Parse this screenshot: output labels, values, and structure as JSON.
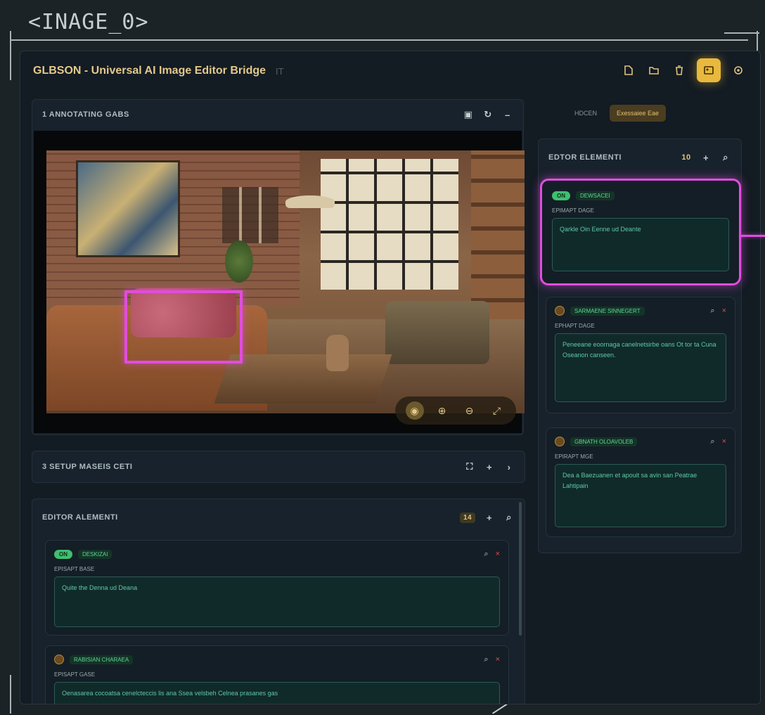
{
  "frame_tag": "<INAGE_0>",
  "app": {
    "title": "GLBSON - Universal AI Image Editor Bridge",
    "title_suffix": "IT"
  },
  "toolbar": {
    "icons": [
      "file-icon",
      "folder-icon",
      "trash-icon",
      "image-mode-icon",
      "settings-icon"
    ],
    "accent": "#e9b83c"
  },
  "image_panel": {
    "title": "1 ANNOTATING GABS",
    "image_tools": [
      "palette-icon",
      "zoom-in-icon",
      "zoom-out-icon",
      "expand-icon"
    ]
  },
  "setup_panel": {
    "title": "3 SETUP MASEIS CETI"
  },
  "editor_left": {
    "title": "EDITOR ALEMENTI",
    "count": "14",
    "cards": [
      {
        "badge": "ON",
        "type": "DESKIZAI",
        "label": "EPISAPT BASE",
        "prompt": "Quite the Denna ud Deana"
      },
      {
        "badge": "",
        "type": "RABISIAN CHARAEA",
        "label": "EPISAPT GASE",
        "prompt": "Oenasarea cocoatsa cenelcteccis lis ana Ssea velsbeh Celnea prasanes gas"
      }
    ]
  },
  "mode_toggle": {
    "options": [
      "HDCEN",
      "Exessaiee Eae"
    ],
    "active": "Exessaiee Eae"
  },
  "editor_right": {
    "title": "EDTOR ELEMENTI",
    "count": "10",
    "cards": [
      {
        "badge": "ON",
        "type": "DEWSACEI",
        "label": "EPIMAPT DAGE",
        "prompt": "Qarkle Oin Eenne ud Deante",
        "highlighted": true
      },
      {
        "badge": "",
        "type": "SARMAENE SINNEGERT",
        "label": "EPHAPT DAGE",
        "prompt": "Peneeane eoornaga canelnetsirbe oans Ot tor ta Cuna Oseanon canseen."
      },
      {
        "badge": "",
        "type": "GBNATH OLOAVOLEB",
        "label": "EPIRAPT MGE",
        "prompt": "Dea a Baezuanen et apouit sa avin san Peatrae Lahtipain"
      }
    ]
  },
  "colors": {
    "highlight": "#e24ce0",
    "prompt_text": "#5fc9a4",
    "badge_on": "#3fbf6f",
    "delete": "#d8504e"
  }
}
